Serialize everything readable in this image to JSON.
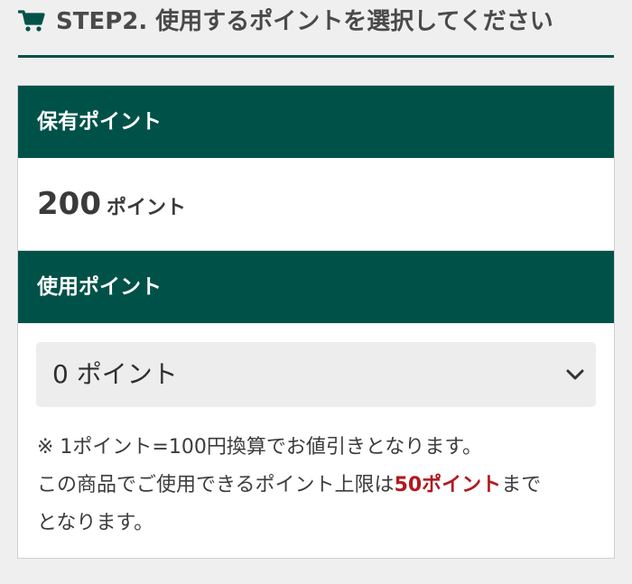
{
  "header": {
    "title": "STEP2. 使用するポイントを選択してください",
    "icon": "cart-icon",
    "accent_color": "#005249"
  },
  "held_points": {
    "label": "保有ポイント",
    "value": "200",
    "unit": "ポイント"
  },
  "use_points": {
    "label": "使用ポイント",
    "select": {
      "selected": "0 ポイント",
      "icon": "chevron-down-icon"
    }
  },
  "notes": {
    "line1": "※ 1ポイント=100円換算でお値引きとなります。",
    "line2_prefix": "この商品でご使用できるポイント上限は",
    "line2_strong": "50ポイント",
    "line2_suffix": "まで",
    "line3": "となります。",
    "strong_color": "#b1191f"
  }
}
